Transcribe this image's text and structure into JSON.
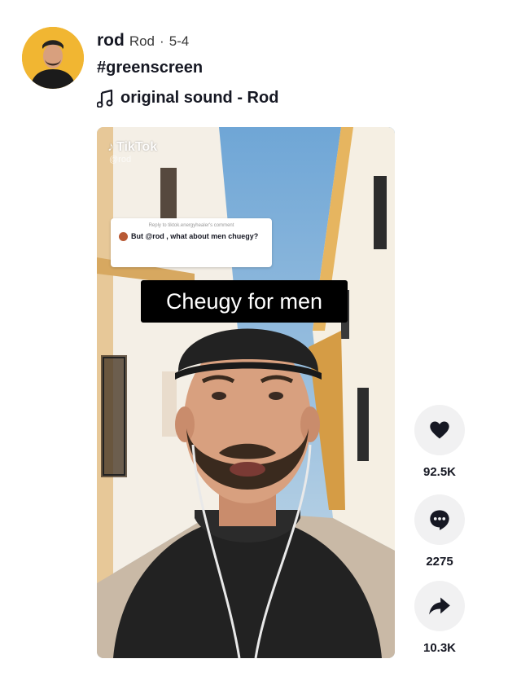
{
  "author": {
    "username": "rod",
    "nickname": "Rod",
    "separator": "·",
    "date": "5-4"
  },
  "caption": "#greenscreen",
  "sound": "original sound - Rod",
  "video": {
    "watermark_brand": "TikTok",
    "watermark_handle": "@rod",
    "reply_header": "Reply to tiktok.energyhealer's comment",
    "reply_text": "But @rod , what about men chuegy?",
    "overlay_text": "Cheugy for men"
  },
  "actions": [
    {
      "icon": "heart-icon",
      "count": "92.5K"
    },
    {
      "icon": "comment-icon",
      "count": "2275"
    },
    {
      "icon": "share-icon",
      "count": "10.3K"
    }
  ]
}
